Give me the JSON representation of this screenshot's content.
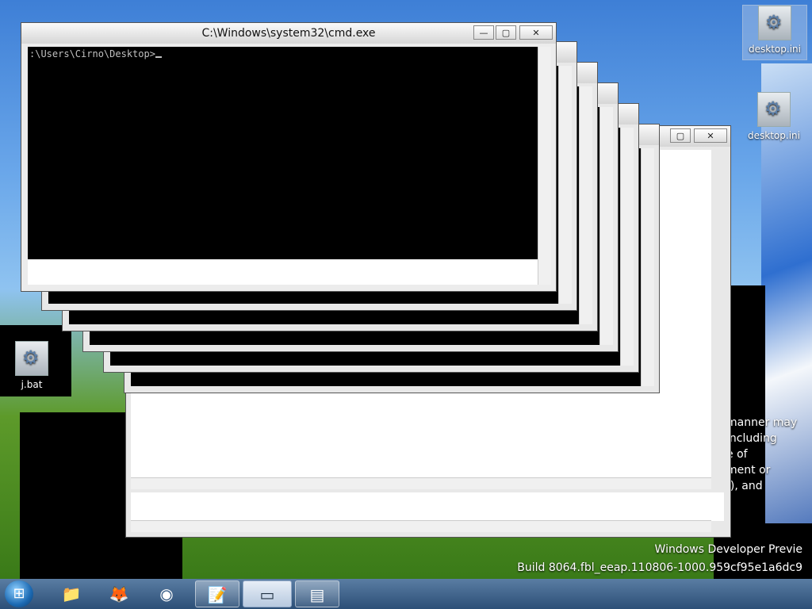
{
  "desktop": {
    "icons": [
      {
        "label": "desktop.ini",
        "selected": true,
        "icon": "settings-file-icon"
      },
      {
        "label": "desktop.ini",
        "selected": false,
        "icon": "settings-file-icon"
      },
      {
        "label": "j.bat",
        "selected": false,
        "icon": "batch-file-icon"
      }
    ],
    "partial_text": [
      "manner may",
      "including",
      "e of",
      "ment or",
      "f), and"
    ]
  },
  "cmd_window": {
    "title": "C:\\Windows\\system32\\cmd.exe",
    "prompt": ":\\Users\\Cirno\\Desktop>",
    "controls": {
      "minimize": "—",
      "maximize": "▢",
      "close": "✕"
    }
  },
  "watermark": {
    "line1": "Windows Developer Previe",
    "line2": "Build 8064.fbl_eeap.110806-1000.959cf95e1a6dc9"
  },
  "taskbar": {
    "start_icon": "windows-start-icon",
    "items": [
      {
        "name": "explorer",
        "icon": "folder-icon",
        "state": "normal"
      },
      {
        "name": "firefox",
        "icon": "firefox-icon",
        "state": "normal"
      },
      {
        "name": "chrome",
        "icon": "chrome-icon",
        "state": "normal"
      },
      {
        "name": "notepad",
        "icon": "notepad-icon",
        "state": "open"
      },
      {
        "name": "cmd",
        "icon": "cmd-icon",
        "state": "active"
      },
      {
        "name": "app",
        "icon": "window-icon",
        "state": "open"
      }
    ]
  }
}
